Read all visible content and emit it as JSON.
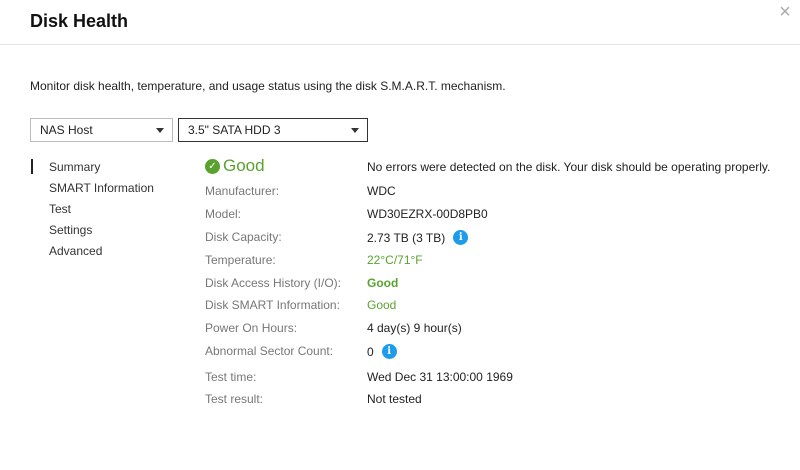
{
  "window": {
    "title": "Disk Health",
    "close_glyph": "×"
  },
  "description": "Monitor disk health, temperature, and usage status using the disk S.M.A.R.T. mechanism.",
  "selectors": {
    "host": {
      "selected": "NAS Host"
    },
    "disk": {
      "selected": "3.5\" SATA HDD 3"
    }
  },
  "nav": {
    "items": [
      {
        "label": "Summary",
        "active": true
      },
      {
        "label": "SMART Information"
      },
      {
        "label": "Test"
      },
      {
        "label": "Settings"
      },
      {
        "label": "Advanced"
      }
    ]
  },
  "summary": {
    "status": "Good",
    "status_icon": "check-circle-icon",
    "status_message": "No errors were detected on the disk. Your disk should be operating properly.",
    "rows": [
      {
        "label": "Manufacturer:",
        "value": "WDC"
      },
      {
        "label": "Model:",
        "value": "WD30EZRX-00D8PB0"
      },
      {
        "label": "Disk Capacity:",
        "value": "2.73 TB (3 TB)",
        "icon": "info-icon"
      },
      {
        "label": "Temperature:",
        "value": "22°C/71°F"
      },
      {
        "label": "Disk Access History (I/O):",
        "value": "Good"
      },
      {
        "label": "Disk SMART Information:",
        "value": "Good"
      },
      {
        "label": "Power On Hours:",
        "value": "4 day(s) 9 hour(s)"
      },
      {
        "label": "Abnormal Sector Count:",
        "value": "0",
        "icon": "info-icon"
      },
      {
        "label": "Test time:",
        "value": "Wed Dec 31 13:00:00 1969"
      },
      {
        "label": "Test result:",
        "value": "Not tested"
      }
    ]
  },
  "colors": {
    "good": "#5aa22e",
    "info": "#1e9be9"
  }
}
